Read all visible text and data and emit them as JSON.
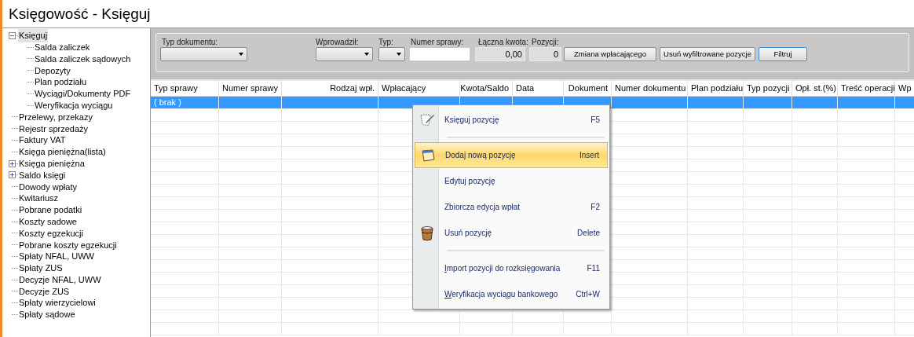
{
  "window": {
    "title": "Księgowość - Księguj"
  },
  "sidebar": {
    "items": [
      {
        "label": "Księguj",
        "expanded": true,
        "selected": true,
        "children": [
          {
            "label": "Salda zaliczek",
            "selected": false
          },
          {
            "label": "Salda zaliczek sądowych",
            "selected": false
          },
          {
            "label": "Depozyty",
            "selected": false
          },
          {
            "label": "Plan podziału",
            "selected": false
          },
          {
            "label": "Wyciągi/Dokumenty PDF",
            "selected": false
          },
          {
            "label": "Weryfikacja wyciągu",
            "selected": false
          }
        ]
      },
      {
        "label": "Przelewy, przekazy",
        "selected": false
      },
      {
        "label": "Rejestr sprzedaży",
        "selected": false
      },
      {
        "label": "Faktury VAT",
        "selected": false
      },
      {
        "label": "Księga pieniężna(lista)",
        "selected": false
      },
      {
        "label": "Księga pieniężna",
        "expanded": false,
        "selected": false
      },
      {
        "label": "Saldo księgi",
        "expanded": false,
        "selected": false
      },
      {
        "label": "Dowody wpłaty",
        "selected": false
      },
      {
        "label": "Kwitariusz",
        "selected": false
      },
      {
        "label": "Pobrane podatki",
        "selected": false
      },
      {
        "label": "Koszty sadowe",
        "selected": false
      },
      {
        "label": "Koszty egzekucji",
        "selected": false
      },
      {
        "label": "Pobrane koszty egzekucji",
        "selected": false
      },
      {
        "label": "Spłaty NFAL, UWW",
        "selected": false
      },
      {
        "label": "Spłaty ZUS",
        "selected": false
      },
      {
        "label": "Decyzje NFAL, UWW",
        "selected": false
      },
      {
        "label": "Decyzje ZUS",
        "selected": false
      },
      {
        "label": "Spłaty wierzycielowi",
        "selected": false
      },
      {
        "label": "Spłaty sądowe",
        "selected": false
      }
    ]
  },
  "filters": {
    "typ_dokumentu": {
      "label": "Typ dokumentu:"
    },
    "wprowadzil": {
      "label": "Wprowadził:"
    },
    "typ": {
      "label": "Typ:"
    },
    "numer_sprawy": {
      "label": "Numer sprawy:"
    },
    "laczna_kwota": {
      "label": "Łączna kwota:",
      "value": "0,00"
    },
    "pozycji": {
      "label": "Pozycji:",
      "value": "0"
    },
    "buttons": [
      {
        "label": "Zmiana wpłacającego",
        "focused": false
      },
      {
        "label": "Usuń wyfiltrowane pozycje",
        "focused": false
      },
      {
        "label": "Filtruj",
        "focused": true
      }
    ]
  },
  "table": {
    "columns": [
      {
        "label": "Typ sprawy"
      },
      {
        "label": "Numer sprawy"
      },
      {
        "label": "Rodzaj wpł."
      },
      {
        "label": "Wpłacający"
      },
      {
        "label": "Kwota/Saldo"
      },
      {
        "label": "Data"
      },
      {
        "label": "Dokument"
      },
      {
        "label": "Numer dokumentu"
      },
      {
        "label": "Plan podziału"
      },
      {
        "label": "Typ pozycji"
      },
      {
        "label": "Opł. st.(%)"
      },
      {
        "label": "Treść operacji"
      },
      {
        "label": "Wp"
      }
    ],
    "rows": [
      {
        "selected": true,
        "cells": [
          "( brak )"
        ]
      }
    ]
  },
  "context_menu": {
    "items": [
      {
        "kind": "item",
        "label": "Księguj pozycję",
        "shortcut": "F5",
        "highlighted": false,
        "underline_first": false
      },
      {
        "kind": "separator"
      },
      {
        "kind": "item",
        "label": "Dodaj nową pozycję",
        "shortcut": "Insert",
        "highlighted": true,
        "underline_first": false
      },
      {
        "kind": "item",
        "label": "Edytuj pozycję",
        "highlighted": false,
        "underline_first": false
      },
      {
        "kind": "item",
        "label": "Zbiorcza edycja wpłat",
        "shortcut": "F2",
        "highlighted": false,
        "underline_first": false
      },
      {
        "kind": "item",
        "label": "Usuń pozycję",
        "shortcut": "Delete",
        "highlighted": false,
        "underline_first": false
      },
      {
        "kind": "separator"
      },
      {
        "kind": "item",
        "label": "Import pozycji do rozksięgowania",
        "shortcut": "F11",
        "highlighted": false,
        "underline_first": true
      },
      {
        "kind": "item",
        "label": "Weryfikacja wyciągu bankowego",
        "shortcut": "Ctrl+W",
        "highlighted": false,
        "underline_first": true
      }
    ]
  }
}
